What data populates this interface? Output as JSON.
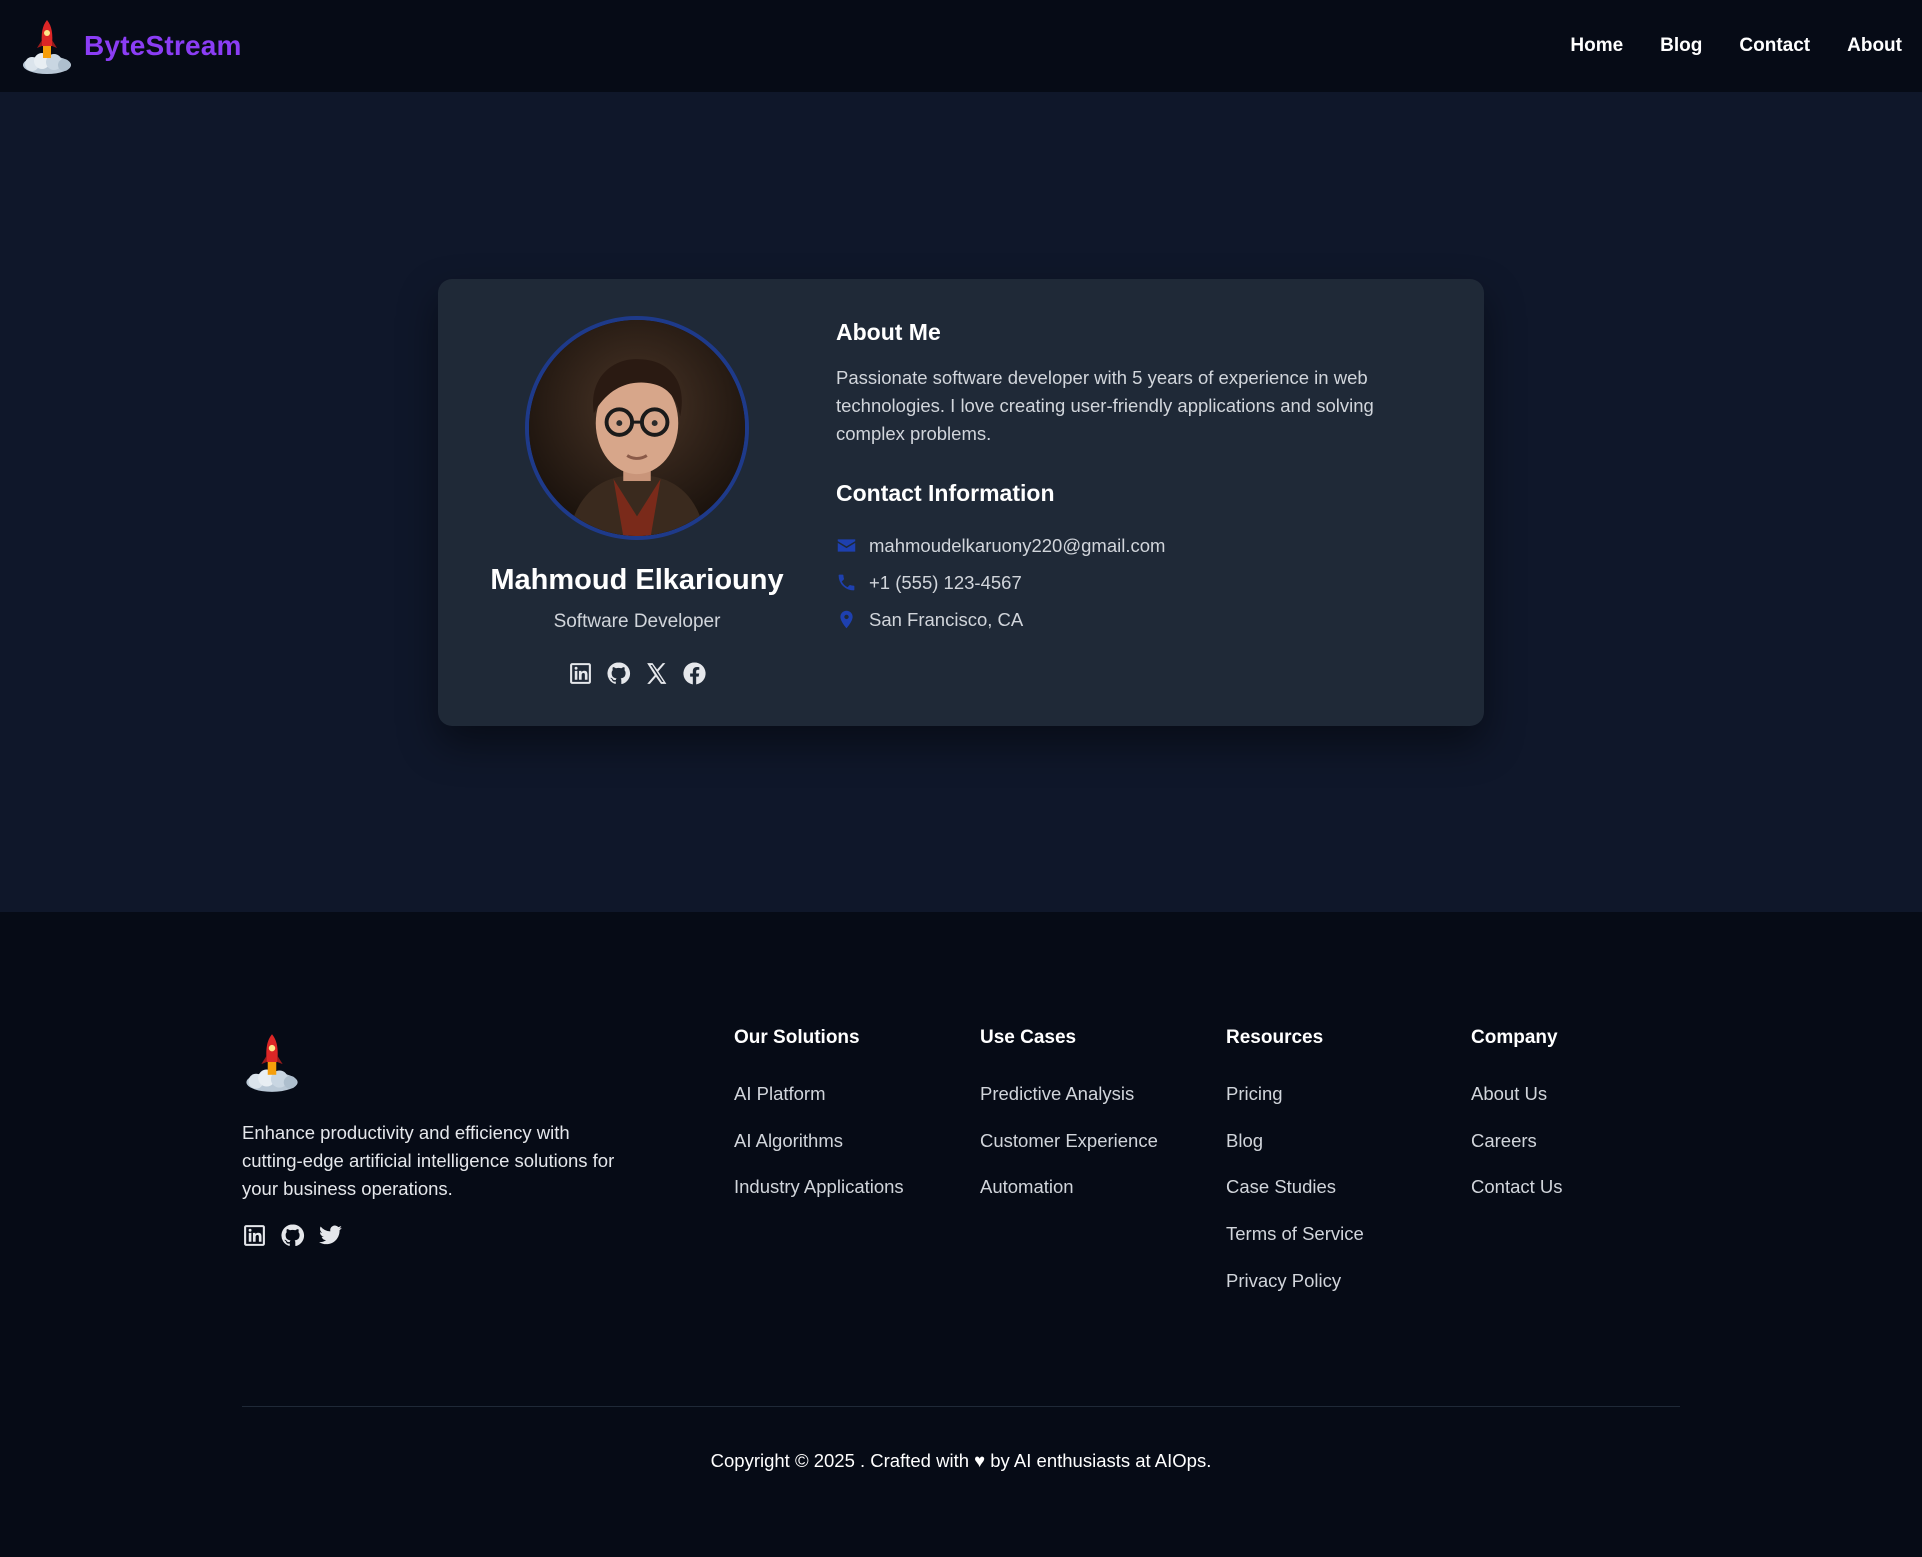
{
  "header": {
    "brand_name": "ByteStream",
    "nav": [
      "Home",
      "Blog",
      "Contact",
      "About"
    ]
  },
  "profile": {
    "name": "Mahmoud Elkariouny",
    "role": "Software Developer",
    "socials": [
      "linkedin-icon",
      "github-icon",
      "x-icon",
      "facebook-icon"
    ]
  },
  "about": {
    "title": "About Me",
    "text": "Passionate software developer with 5 years of experience in web technologies. I love creating user-friendly applications and solving complex problems."
  },
  "contact": {
    "title": "Contact Information",
    "email": "mahmoudelkaruony220@gmail.com",
    "phone": "+1 (555) 123-4567",
    "location": "San Francisco, CA"
  },
  "footer": {
    "description": "Enhance productivity and efficiency with cutting-edge artificial intelligence solutions for your business operations.",
    "socials": [
      "linkedin-icon",
      "github-icon",
      "twitter-icon"
    ],
    "columns": [
      {
        "title": "Our Solutions",
        "items": [
          "AI Platform",
          "AI Algorithms",
          "Industry Applications"
        ]
      },
      {
        "title": "Use Cases",
        "items": [
          "Predictive Analysis",
          "Customer Experience",
          "Automation"
        ]
      },
      {
        "title": "Resources",
        "items": [
          "Pricing",
          "Blog",
          "Case Studies",
          "Terms of Service",
          "Privacy Policy"
        ]
      },
      {
        "title": "Company",
        "items": [
          "About Us",
          "Careers",
          "Contact Us"
        ]
      }
    ],
    "copyright": "Copyright © 2025 . Crafted with ♥ by AI enthusiasts at AIOps."
  },
  "colors": {
    "brand": "#8b3df5",
    "background": "#0f172a",
    "header_footer": "#060b16",
    "card": "#1f2937",
    "accent_icon": "#1e40af"
  }
}
